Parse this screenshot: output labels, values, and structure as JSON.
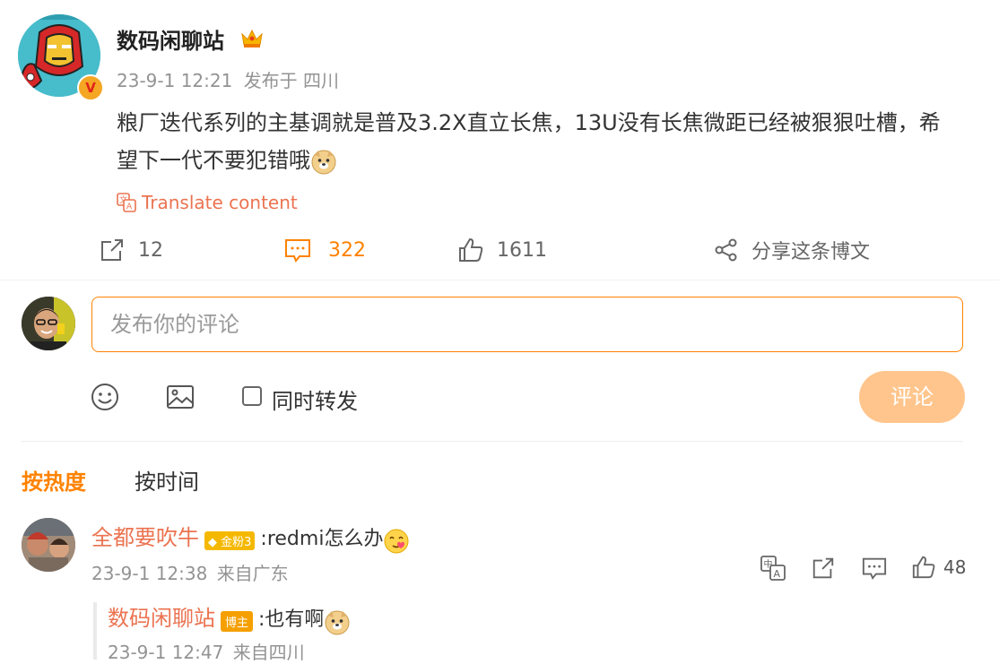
{
  "post": {
    "author": "数码闲聊站",
    "time": "23-9-1 12:21",
    "source": "发布于 四川",
    "text": "粮厂迭代系列的主基调就是普及3.2X直立长焦，13U没有长焦微距已经被狠狠吐槽，希望下一代不要犯错哦",
    "verified_badge": "V",
    "translate_label": "Translate content",
    "repost_count": "12",
    "comment_count": "322",
    "like_count": "1611",
    "share_label": "分享这条博文"
  },
  "composer": {
    "placeholder": "发布你的评论",
    "repost_label": "同时转发",
    "submit_label": "评论"
  },
  "sort": {
    "hot": "按热度",
    "time": "按时间"
  },
  "comments": [
    {
      "author": "全都要吹牛",
      "badge": "金粉3",
      "text": ":redmi怎么办",
      "time": "23-9-1 12:38",
      "location": "来自广东",
      "likes": "48",
      "reply": {
        "author": "数码闲聊站",
        "badge": "博主",
        "text": ":也有啊",
        "time": "23-9-1 12:47",
        "location": "来自四川"
      }
    }
  ],
  "colors": {
    "accent": "#ff8200",
    "name": "#eb7350",
    "meta": "#939393"
  }
}
